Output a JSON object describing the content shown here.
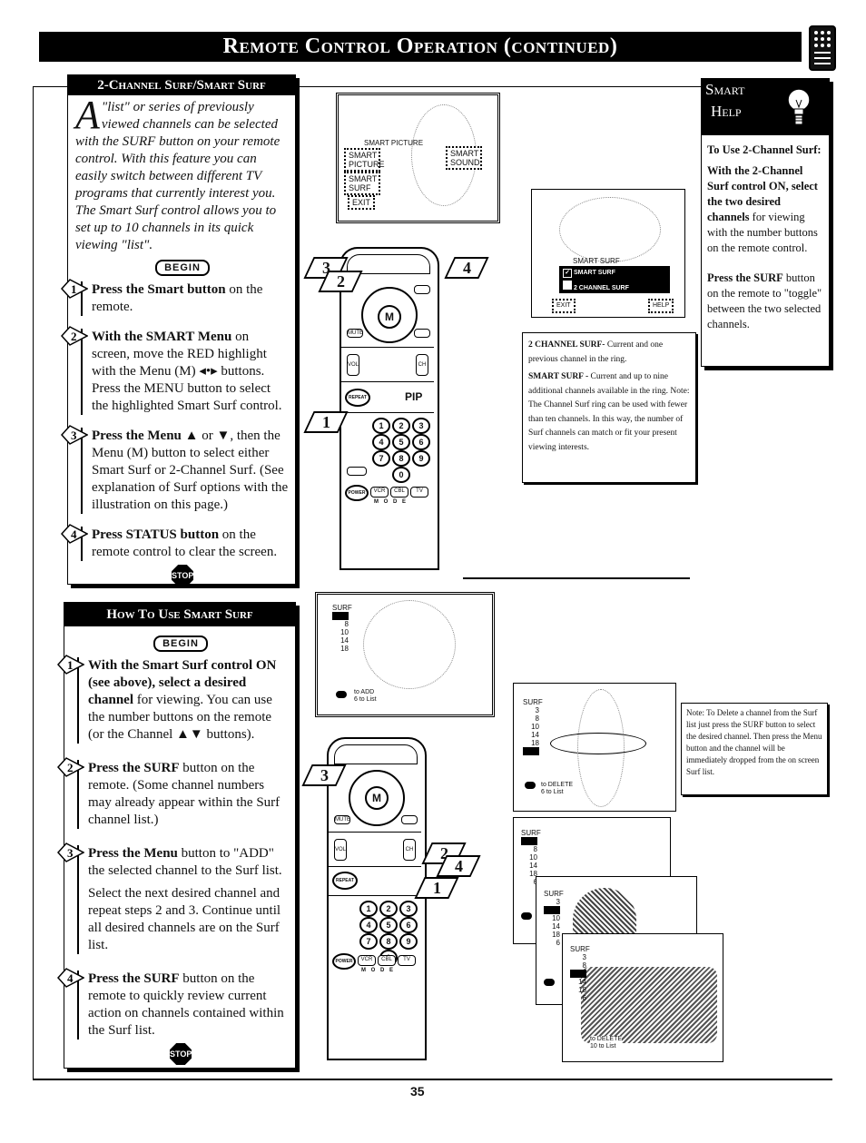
{
  "header": {
    "title": "Remote Control Operation (continued)",
    "tab_icon": "remote-control-icon"
  },
  "two_channel_panel": {
    "heading": "2-Channel Surf/Smart Surf",
    "intro_dropcap": "A",
    "intro": "\"list\" or series of previously viewed channels can be selected with the SURF button on your remote control. With this feature you can easily switch between different TV programs that currently interest you. The Smart Surf control allows you to set up to 10 channels in its quick viewing \"list\".",
    "begin_label": "BEGIN",
    "steps": [
      {
        "num": "1",
        "bold": "Press the Smart button",
        "text": " on the remote."
      },
      {
        "num": "2",
        "bold": "With the SMART Menu",
        "text": " on screen, move the RED highlight with the Menu (M) ◂•▸ buttons. Press the MENU button to select the highlighted Smart Surf control."
      },
      {
        "num": "3",
        "bold": "Press the Menu ▲",
        "text": " or ▼, then the Menu (M) button to select either Smart Surf or 2-Channel Surf. (See explanation of Surf options with the illustration on this page.)"
      },
      {
        "num": "4",
        "bold": "Press STATUS button",
        "text": " on the remote control to clear the screen."
      }
    ],
    "stop_label": "STOP"
  },
  "how_to_panel": {
    "heading": "How To Use Smart Surf",
    "begin_label": "BEGIN",
    "steps": [
      {
        "num": "1",
        "bold": "With the Smart Surf control ON (see above), select a desired channel",
        "text": " for viewing. You can use the number buttons on the remote (or the Channel ▲▼ buttons)."
      },
      {
        "num": "2",
        "bold": "Press the SURF",
        "text": " button on the remote. (Some channel numbers may already appear within the Surf channel list.)"
      },
      {
        "num": "3",
        "bold": "Press the Menu",
        "text": " button to \"ADD\" the selected channel to the Surf list.",
        "extra": "Select the next desired channel and repeat steps 2 and 3. Continue until all desired channels are on the Surf list."
      },
      {
        "num": "4",
        "bold": "Press the SURF",
        "text": " button on the remote to quickly review current action on channels contained within the Surf list."
      }
    ],
    "stop_label": "STOP"
  },
  "smart_help": {
    "heading_line1": "Smart",
    "heading_line2": "Help",
    "icon": "lightbulb-icon",
    "subtitle": "To Use 2-Channel Surf:",
    "para1_bold": "With the 2-Channel Surf control ON, select the two desired channels",
    "para1_text": " for viewing with the number buttons on the remote control.",
    "para2_bold": "Press the SURF",
    "para2_text": " button on the remote to \"toggle\" between the two selected channels."
  },
  "smart_menu_screen": {
    "label": "SMART PICTURE",
    "buttons": [
      "SMART PICTURE",
      "SMART SURF",
      "EXIT",
      "SMART SOUND"
    ]
  },
  "surf_menu_screen": {
    "label": "SMART SURF",
    "options": [
      {
        "label": "SMART SURF",
        "checked": true
      },
      {
        "label": "2 CHANNEL SURF",
        "checked": false
      }
    ],
    "exit_label": "EXIT",
    "help_label": "HELP"
  },
  "surf_explanation": {
    "item1_bold": "2 CHANNEL SURF-",
    "item1_text": " Current and one previous channel in the ring.",
    "item2_bold": "SMART SURF -",
    "item2_text": " Current and up to nine additional channels available in the ring. Note: The Channel Surf ring can be used with fewer than ten channels. In this way,  the number of Surf channels can match or fit your present viewing interests."
  },
  "delete_note": {
    "text": "Note: To Delete a channel from the Surf list just press the SURF button to select the desired channel. Then press the Menu button and the channel will be immediately dropped from the on screen Surf list."
  },
  "add_screen": {
    "title": "SURF",
    "channels": [
      "?",
      "8",
      "10",
      "14",
      "18"
    ],
    "action_line1": "to ADD",
    "action_line2": "6 to List"
  },
  "delete_screen": {
    "title": "SURF",
    "channels": [
      "3",
      "8",
      "10",
      "14",
      "18",
      "?"
    ],
    "action_line1": "to DELETE",
    "action_line2": "6 to List"
  },
  "stack_screens": [
    {
      "title": "SURF",
      "channels": [
        "?",
        "8",
        "10",
        "14",
        "18",
        "6"
      ]
    },
    {
      "title": "SURF",
      "channels": [
        "3",
        "?",
        "10",
        "14",
        "18",
        "6"
      ]
    },
    {
      "title": "SURF",
      "channels": [
        "3",
        "8",
        "?",
        "14",
        "18",
        "6"
      ],
      "action_line1": "to DELETE",
      "action_line2": "10 to List"
    }
  ],
  "remote_callouts_top": [
    "3",
    "2",
    "4",
    "1"
  ],
  "remote_callouts_bottom": [
    "3",
    "2",
    "4",
    "1"
  ],
  "remote": {
    "m_label": "M",
    "pip_label": "PIP",
    "mode_label": "M O D E",
    "keys": [
      "1",
      "2",
      "3",
      "4",
      "5",
      "6",
      "7",
      "8",
      "9",
      "0"
    ],
    "mode_keys": [
      "VCR",
      "CBL",
      "TV"
    ],
    "power_label": "POWER",
    "repeat_label": "REPEAT",
    "vol_label": "VOL",
    "ch_label": "CH",
    "mute_label": "MUTE"
  },
  "footer": {
    "page_number": "35"
  }
}
